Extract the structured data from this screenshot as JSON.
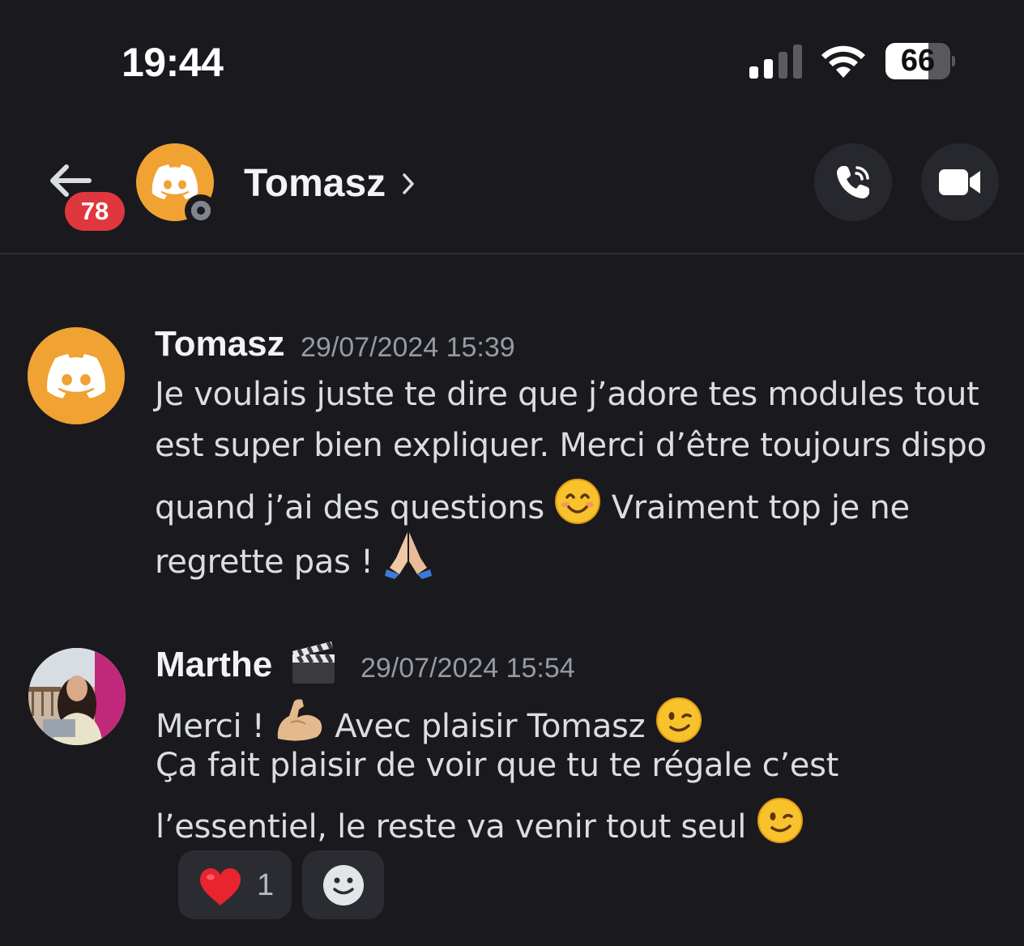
{
  "status_bar": {
    "time": "19:44",
    "battery_level": "66",
    "battery_fraction": 0.66,
    "signal_bars_filled": 2,
    "signal_bars_total": 4
  },
  "header": {
    "back_icon": "arrow-left-icon",
    "unread_badge": "78",
    "contact_name": "Tomasz",
    "chevron_icon": "chevron-right-icon",
    "call_icon": "phone-icon",
    "video_icon": "video-camera-icon",
    "presence": "offline"
  },
  "messages": [
    {
      "author": "Tomasz",
      "timestamp": "29/07/2024 15:39",
      "avatar_icon": "discord-logo-icon",
      "avatar_color": "#f0a232",
      "lines": [
        "Je voulais juste te dire que j’adore tes modules tout",
        "est super bien expliquer. Merci d’être toujours dispo",
        "quand j’ai des questions",
        "Vraiment top je ne",
        "regrette pas !"
      ],
      "emojis": [
        "smiling-face-emoji",
        "folded-hands-emoji"
      ]
    },
    {
      "author": "Marthe",
      "author_emoji": "clapper-board-emoji",
      "timestamp": "29/07/2024 15:54",
      "avatar_icon": "user-photo",
      "lines": [
        "Merci !",
        "Avec plaisir Tomasz",
        "Ça fait plaisir de voir que tu te régale c’est",
        "l’essentiel, le reste va venir tout seul"
      ],
      "emojis": [
        "flexed-biceps-emoji",
        "winking-face-emoji",
        "winking-face-emoji"
      ],
      "reactions": [
        {
          "emoji": "red-heart-emoji",
          "count": "1"
        }
      ],
      "add_reaction_icon": "add-reaction-smiley-icon"
    }
  ],
  "colors": {
    "background": "#1a1a1e",
    "accent_orange": "#f0a232",
    "badge_red": "#e0363e",
    "timestamp_gray": "#949ba4",
    "text": "#dbdee1"
  }
}
